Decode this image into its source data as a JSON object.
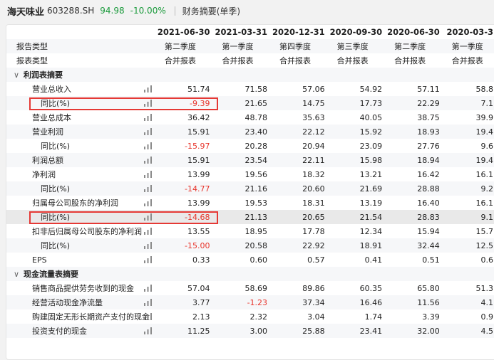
{
  "header": {
    "stock_name": "海天味业",
    "stock_code": "603288.SH",
    "price": "94.98",
    "change": "-10.00%",
    "section_title": "财务摘要(单季)"
  },
  "columns": [
    "2021-06-30",
    "2021-03-31",
    "2020-12-31",
    "2020-09-30",
    "2020-06-30",
    "2020-03-3"
  ],
  "meta_rows": [
    {
      "label": "报告类型",
      "values": [
        "第二季度",
        "第一季度",
        "第四季度",
        "第三季度",
        "第二季度",
        "第一季度"
      ]
    },
    {
      "label": "报表类型",
      "values": [
        "合并报表",
        "合并报表",
        "合并报表",
        "合并报表",
        "合并报表",
        "合并报表"
      ]
    }
  ],
  "sections": [
    {
      "title": "利润表摘要",
      "rows": [
        {
          "label": "营业总收入",
          "indent": 1,
          "values": [
            "51.74",
            "71.58",
            "57.06",
            "54.92",
            "57.11",
            "58.8"
          ]
        },
        {
          "label": "同比(%)",
          "indent": 2,
          "values": [
            "-9.39",
            "21.65",
            "14.75",
            "17.73",
            "22.29",
            "7.1"
          ]
        },
        {
          "label": "营业总成本",
          "indent": 1,
          "values": [
            "36.42",
            "48.78",
            "35.63",
            "40.05",
            "38.75",
            "39.9"
          ]
        },
        {
          "label": "营业利润",
          "indent": 1,
          "values": [
            "15.91",
            "23.40",
            "22.12",
            "15.92",
            "18.93",
            "19.4"
          ]
        },
        {
          "label": "同比(%)",
          "indent": 2,
          "values": [
            "-15.97",
            "20.28",
            "20.94",
            "23.09",
            "27.76",
            "9.6"
          ]
        },
        {
          "label": "利润总额",
          "indent": 1,
          "values": [
            "15.91",
            "23.54",
            "22.11",
            "15.98",
            "18.94",
            "19.4"
          ]
        },
        {
          "label": "净利润",
          "indent": 1,
          "values": [
            "13.99",
            "19.56",
            "18.32",
            "13.21",
            "16.42",
            "16.1"
          ]
        },
        {
          "label": "同比(%)",
          "indent": 2,
          "values": [
            "-14.77",
            "21.16",
            "20.60",
            "21.69",
            "28.88",
            "9.2"
          ]
        },
        {
          "label": "归属母公司股东的净利润",
          "indent": 1,
          "values": [
            "13.99",
            "19.53",
            "18.31",
            "13.19",
            "16.40",
            "16.1"
          ]
        },
        {
          "label": "同比(%)",
          "indent": 2,
          "values": [
            "-14.68",
            "21.13",
            "20.65",
            "21.54",
            "28.83",
            "9.1"
          ]
        },
        {
          "label": "扣非后归属母公司股东的净利润",
          "indent": 1,
          "values": [
            "13.55",
            "18.95",
            "17.78",
            "12.34",
            "15.94",
            "15.7"
          ]
        },
        {
          "label": "同比(%)",
          "indent": 2,
          "values": [
            "-15.00",
            "20.58",
            "22.92",
            "18.91",
            "32.44",
            "12.5"
          ]
        },
        {
          "label": "EPS",
          "indent": 1,
          "values": [
            "0.33",
            "0.60",
            "0.57",
            "0.41",
            "0.51",
            "0.6"
          ]
        }
      ]
    },
    {
      "title": "现金流量表摘要",
      "rows": [
        {
          "label": "销售商品提供劳务收到的现金",
          "indent": 1,
          "values": [
            "57.04",
            "58.69",
            "89.86",
            "60.35",
            "65.80",
            "51.3"
          ]
        },
        {
          "label": "经营活动现金净流量",
          "indent": 1,
          "values": [
            "3.77",
            "-1.23",
            "37.34",
            "16.46",
            "11.56",
            "4.1"
          ]
        },
        {
          "label": "购建固定无形长期资产支付的现金",
          "indent": 1,
          "values": [
            "2.13",
            "2.32",
            "3.04",
            "1.74",
            "3.39",
            "0.9"
          ]
        },
        {
          "label": "投资支付的现金",
          "indent": 1,
          "values": [
            "11.25",
            "3.00",
            "25.88",
            "23.41",
            "32.00",
            "4.5"
          ]
        }
      ]
    }
  ],
  "colors": {
    "negative": "#e8352c",
    "positive_change": "#1a9a3b",
    "highlight_box": "#e53935"
  }
}
